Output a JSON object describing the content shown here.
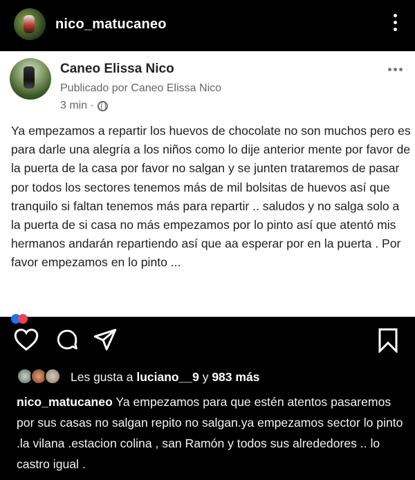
{
  "header": {
    "username": "nico_matucaneo"
  },
  "fb_post": {
    "author": "Caneo Elissa Nico",
    "published_by": "Publicado por Caneo Elissa Nico",
    "time": "3 min ·",
    "body": "Ya empezamos a repartir los huevos de chocolate no son muchos pero  es para darle una alegría a los niños como lo dije anterior mente por favor de la puerta de la casa por favor no salgan y se junten trataremos de pasar por todos los sectores tenemos más de mil bolsitas de huevos así que tranquilo si faltan tenemos más para repartir .. saludos y no salga solo a la puerta de si casa no más empezamos por lo pinto así que atentó mis hermanos andarán repartiendo así que aa esperar por en la puerta . Por favor empezamos en lo pinto ..."
  },
  "actions": {
    "like_icon": "heart-icon",
    "comment_icon": "comment-icon",
    "share_icon": "paper-plane-icon",
    "save_icon": "bookmark-icon"
  },
  "likes": {
    "prefix": "Les gusta a",
    "user": "luciano__9",
    "connector": "y",
    "count": "983 más"
  },
  "caption": {
    "username": "nico_matucaneo",
    "text": "Ya empezamos para que estén atentos pasaremos por sus casas no salgan repito no salgan.ya empezamos  sector lo pinto .la vilana .estacion colina , san Ramón y todos sus alrededores .. lo castro igual ."
  },
  "colors": {
    "background": "#000000",
    "post_background": "#ffffff",
    "text_dark": "#1c1e21",
    "muted_gray": "#666666"
  }
}
